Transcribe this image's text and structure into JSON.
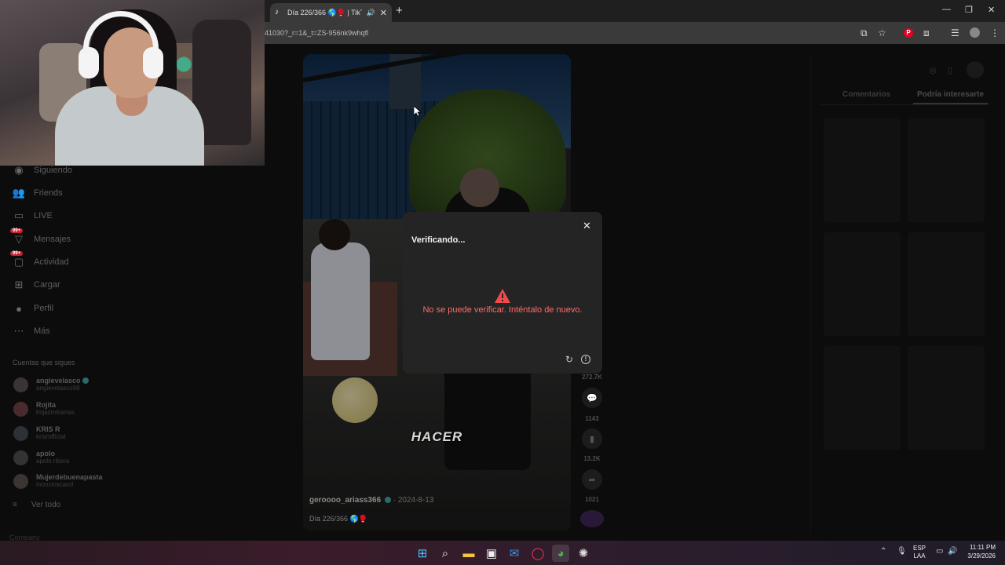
{
  "browser": {
    "tab_title": "Día 226/366 🌎🥊 | TikTok",
    "url": "41030?_r=1&_t=ZS-956nk9whqfl"
  },
  "sidebar": {
    "items": [
      {
        "label": "Siguiendo",
        "icon": "following-icon"
      },
      {
        "label": "Friends",
        "icon": "friends-icon"
      },
      {
        "label": "LIVE",
        "icon": "live-icon"
      },
      {
        "label": "Mensajes",
        "icon": "messages-icon",
        "badge": "99+"
      },
      {
        "label": "Actividad",
        "icon": "activity-icon",
        "badge": "99+"
      },
      {
        "label": "Cargar",
        "icon": "upload-icon"
      },
      {
        "label": "Perfil",
        "icon": "profile-icon"
      },
      {
        "label": "Más",
        "icon": "more-icon"
      }
    ],
    "following_header": "Cuentas que sigues",
    "accounts": [
      {
        "name": "angievelasco",
        "user": "angievelasco98",
        "verified": true
      },
      {
        "name": "Rojita",
        "user": "lmjazminarias",
        "verified": false
      },
      {
        "name": "KRIS R",
        "user": "krisrofficial",
        "verified": false
      },
      {
        "name": "apolo",
        "user": "apolo.ribera",
        "verified": false
      },
      {
        "name": "Mujerdebuenapasta",
        "user": "moncloscarol",
        "verified": false
      }
    ],
    "see_all": "Ver todo",
    "company": "Company"
  },
  "video": {
    "caption_overlay": "HACER",
    "author": "geroooo_ariass366",
    "date": "· 2024-8-13",
    "description": "Día 226/366 🌎🥊"
  },
  "actions": {
    "likes": "272.7K",
    "comments": "1143",
    "saves": "13.2K",
    "shares": "1021"
  },
  "right_panel": {
    "tabs": [
      "Comentarios",
      "Podría interesarte"
    ],
    "active_tab": "Podría interesarte"
  },
  "modal": {
    "title": "Verificando...",
    "error": "No se puede verificar. Inténtalo de nuevo."
  },
  "taskbar": {
    "lang_top": "ESP",
    "lang_bottom": "LAA",
    "time": "11:11 PM",
    "date": "3/29/2026"
  },
  "colors": {
    "error": "#ff6b6b",
    "modal_bg": "#242424",
    "pinterest": "#e60023"
  }
}
